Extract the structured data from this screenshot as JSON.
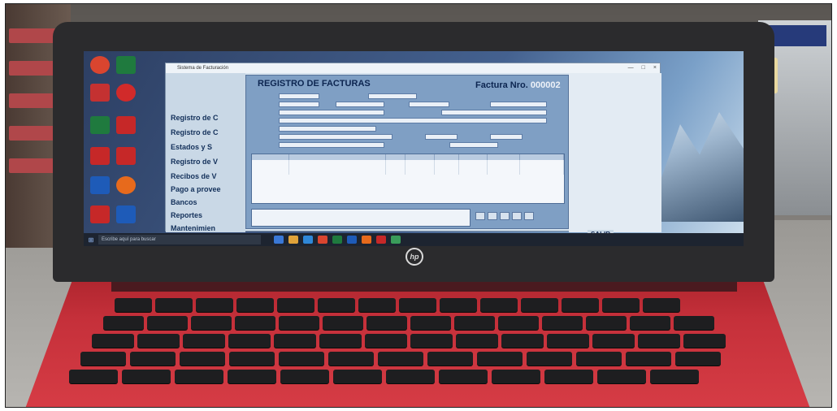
{
  "app": {
    "window_title": "Sistema de Facturación",
    "form_title": "REGISTRO DE FACTURAS",
    "invoice_label": "Factura Nro.",
    "invoice_number": "000002",
    "exit_button": "SALIR"
  },
  "side_menu": [
    "Registro de C",
    "Registro de C",
    "Estados y S",
    "Registro de V",
    "Recibos de V",
    "Pago a provee",
    "Bancos",
    "Reportes",
    "Mantenimien"
  ],
  "desktop": {
    "mountain_wallpaper": "mountain",
    "icons": [
      "chrome",
      "excel",
      "acrobat",
      "word",
      "pdf",
      "pdf",
      "firefox",
      "word"
    ]
  },
  "taskbar": {
    "search_placeholder": "Escribe aquí para buscar"
  },
  "colors": {
    "laptop_body": "#c5303a",
    "lid": "#2b2b2d",
    "form_panel": "#7f9fc4"
  }
}
